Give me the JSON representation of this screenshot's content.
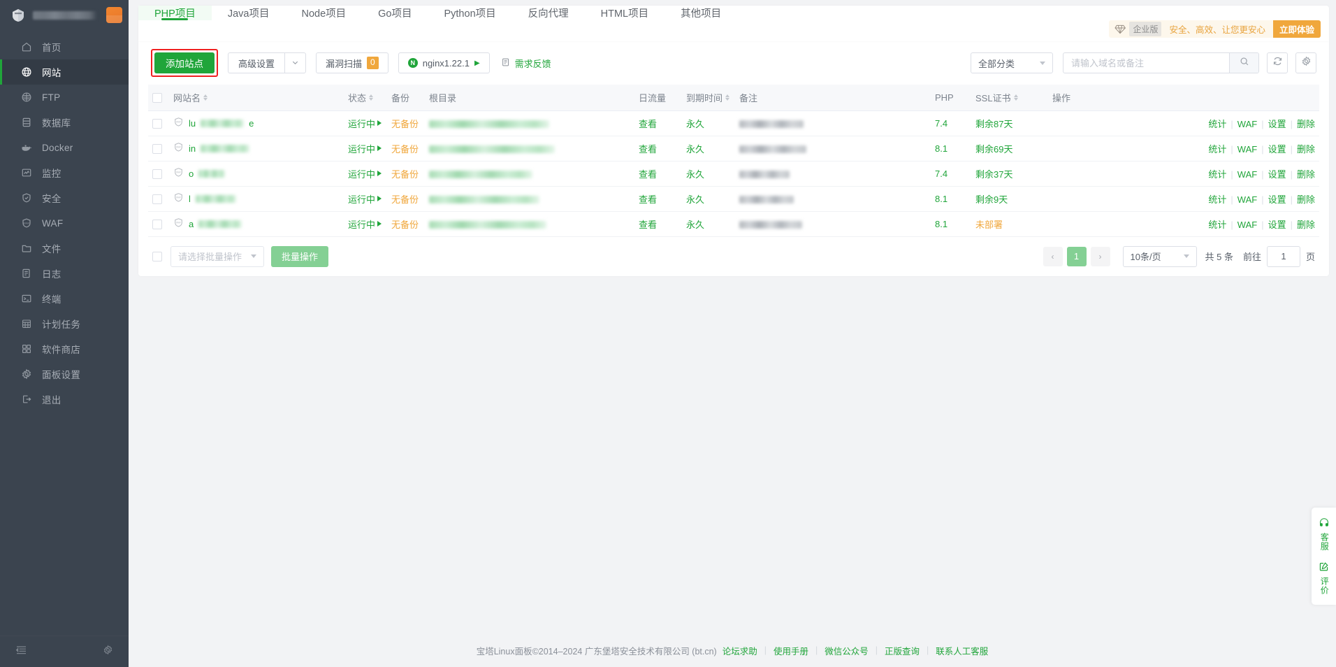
{
  "sidebar": {
    "header": {
      "logo_icon": "bt-panel-logo-icon",
      "username_redacted": true,
      "avatar_icon": "user-avatar"
    },
    "items": [
      {
        "label": "首页",
        "icon": "home-icon",
        "active": false
      },
      {
        "label": "网站",
        "icon": "globe-icon",
        "active": true
      },
      {
        "label": "FTP",
        "icon": "ftp-globe-icon",
        "active": false
      },
      {
        "label": "数据库",
        "icon": "database-icon",
        "active": false
      },
      {
        "label": "Docker",
        "icon": "docker-icon",
        "active": false
      },
      {
        "label": "监控",
        "icon": "monitor-chart-icon",
        "active": false
      },
      {
        "label": "安全",
        "icon": "shield-check-icon",
        "active": false
      },
      {
        "label": "WAF",
        "icon": "shield-waf-icon",
        "active": false
      },
      {
        "label": "文件",
        "icon": "folder-icon",
        "active": false
      },
      {
        "label": "日志",
        "icon": "log-list-icon",
        "active": false
      },
      {
        "label": "终端",
        "icon": "terminal-icon",
        "active": false
      },
      {
        "label": "计划任务",
        "icon": "calendar-task-icon",
        "active": false
      },
      {
        "label": "软件商店",
        "icon": "apps-grid-icon",
        "active": false
      },
      {
        "label": "面板设置",
        "icon": "gear-icon",
        "active": false
      },
      {
        "label": "退出",
        "icon": "logout-icon",
        "active": false
      }
    ],
    "footer": {
      "collapse_icon": "collapse-sidebar-icon",
      "settings_icon": "gear-icon"
    }
  },
  "tabs": [
    {
      "label": "PHP项目",
      "active": true
    },
    {
      "label": "Java项目",
      "active": false
    },
    {
      "label": "Node项目",
      "active": false
    },
    {
      "label": "Go项目",
      "active": false
    },
    {
      "label": "Python项目",
      "active": false
    },
    {
      "label": "反向代理",
      "active": false
    },
    {
      "label": "HTML项目",
      "active": false
    },
    {
      "label": "其他项目",
      "active": false
    }
  ],
  "promo": {
    "diamond_icon": "diamond-icon",
    "badge": "企业版",
    "text": "安全、高效、让您更安心",
    "button": "立即体验"
  },
  "toolbar": {
    "add_site": "添加站点",
    "advanced_settings": "高级设置",
    "caret_icon": "chevron-down-icon",
    "vuln_scan": "漏洞扫描",
    "vuln_count": "0",
    "nginx": "nginx1.22.1",
    "nginx_icon": "nginx-icon",
    "nginx_play_icon": "play-icon",
    "feedback": "需求反馈",
    "feedback_icon": "feedback-note-icon",
    "category_select": "全部分类",
    "search_placeholder": "请输入域名或备注",
    "search_value": "",
    "search_icon": "search-icon",
    "refresh_icon": "refresh-icon",
    "settings_icon": "gear-icon"
  },
  "table": {
    "columns": [
      {
        "label": "",
        "key": "checkbox",
        "sortable": false
      },
      {
        "label": "网站名",
        "key": "site",
        "sortable": true
      },
      {
        "label": "状态",
        "key": "status",
        "sortable": true
      },
      {
        "label": "备份",
        "key": "backup",
        "sortable": false
      },
      {
        "label": "根目录",
        "key": "root",
        "sortable": false
      },
      {
        "label": "日流量",
        "key": "traffic",
        "sortable": false
      },
      {
        "label": "到期时间",
        "key": "expire",
        "sortable": true
      },
      {
        "label": "备注",
        "key": "note",
        "sortable": false
      },
      {
        "label": "PHP",
        "key": "php",
        "sortable": false
      },
      {
        "label": "SSL证书",
        "key": "ssl",
        "sortable": true
      },
      {
        "label": "操作",
        "key": "ops",
        "sortable": false
      }
    ],
    "rows": [
      {
        "site_prefix": "lu",
        "site_suffix": "e",
        "site_redacted_width": 62,
        "status": "运行中",
        "backup": "无备份",
        "root_redacted_width": 172,
        "traffic": "查看",
        "expire": "永久",
        "note_redacted_width": 92,
        "php": "7.4",
        "ssl": "剩余87天",
        "ssl_state": "ok",
        "ops": [
          "统计",
          "WAF",
          "设置",
          "删除"
        ]
      },
      {
        "site_prefix": "in",
        "site_suffix": "",
        "site_redacted_width": 70,
        "status": "运行中",
        "backup": "无备份",
        "root_redacted_width": 180,
        "traffic": "查看",
        "expire": "永久",
        "note_redacted_width": 96,
        "php": "8.1",
        "ssl": "剩余69天",
        "ssl_state": "ok",
        "ops": [
          "统计",
          "WAF",
          "设置",
          "删除"
        ]
      },
      {
        "site_prefix": "o",
        "site_suffix": "",
        "site_redacted_width": 38,
        "status": "运行中",
        "backup": "无备份",
        "root_redacted_width": 148,
        "traffic": "查看",
        "expire": "永久",
        "note_redacted_width": 72,
        "php": "7.4",
        "ssl": "剩余37天",
        "ssl_state": "ok",
        "ops": [
          "统计",
          "WAF",
          "设置",
          "删除"
        ]
      },
      {
        "site_prefix": "l",
        "site_suffix": "",
        "site_redacted_width": 58,
        "status": "运行中",
        "backup": "无备份",
        "root_redacted_width": 158,
        "traffic": "查看",
        "expire": "永久",
        "note_redacted_width": 78,
        "php": "8.1",
        "ssl": "剩余9天",
        "ssl_state": "ok",
        "ops": [
          "统计",
          "WAF",
          "设置",
          "删除"
        ]
      },
      {
        "site_prefix": "a",
        "site_suffix": "",
        "site_redacted_width": 62,
        "status": "运行中",
        "backup": "无备份",
        "root_redacted_width": 168,
        "traffic": "查看",
        "expire": "永久",
        "note_redacted_width": 90,
        "php": "8.1",
        "ssl": "未部署",
        "ssl_state": "warn",
        "ops": [
          "统计",
          "WAF",
          "设置",
          "删除"
        ]
      }
    ]
  },
  "table_footer": {
    "batch_placeholder": "请选择批量操作",
    "batch_button": "批量操作",
    "prev_icon": "chevron-left-icon",
    "page_current": "1",
    "next_icon": "chevron-right-icon",
    "page_size": "10条/页",
    "total_text": "共 5 条",
    "goto_label": "前往",
    "goto_value": "1",
    "page_unit": "页"
  },
  "page_footer": {
    "copyright": "宝塔Linux面板©2014–2024 广东堡塔安全技术有限公司 (bt.cn)",
    "links": [
      "论坛求助",
      "使用手册",
      "微信公众号",
      "正版查询",
      "联系人工客服"
    ]
  },
  "rail": [
    {
      "label": "客服",
      "icon": "headset-icon"
    },
    {
      "label": "评价",
      "icon": "edit-square-icon"
    }
  ],
  "colors": {
    "brand_green": "#20a53a",
    "orange": "#f0a73c",
    "sidebar_bg": "#3b444f",
    "sidebar_active": "#333b45",
    "page_bg": "#f2f3f5",
    "highlight_red": "#f02020"
  }
}
